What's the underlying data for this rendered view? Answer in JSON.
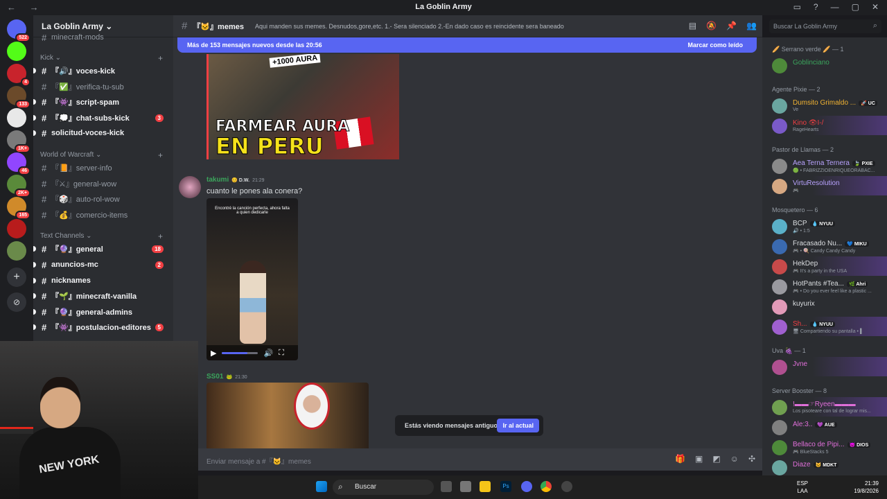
{
  "window": {
    "title": "La Goblin Army",
    "nav": "← →",
    "controls": [
      "▭",
      "?",
      "—",
      "▢",
      "✕"
    ]
  },
  "servers": [
    {
      "color": "#5865f2",
      "badge": "522",
      "icon": "discord-home-icon"
    },
    {
      "color": "#53fc18",
      "badge": "",
      "icon": "kick-icon"
    },
    {
      "color": "#c8232c",
      "badge": "4",
      "icon": "server-icon"
    },
    {
      "color": "#6b4a2a",
      "badge": "133",
      "icon": "server-icon"
    },
    {
      "color": "#e8e8e8",
      "badge": "",
      "icon": "server-icon"
    },
    {
      "color": "#7a7a7a",
      "badge": "1K+",
      "icon": "server-icon"
    },
    {
      "color": "#9146ff",
      "badge": "46",
      "icon": "twitch-icon"
    },
    {
      "color": "#5a8a3a",
      "badge": "2K+",
      "icon": "server-icon"
    },
    {
      "color": "#d08a2a",
      "badge": "165",
      "icon": "server-icon"
    },
    {
      "color": "#b81c1c",
      "badge": "",
      "icon": "server-icon"
    },
    {
      "color": "#6a8a4a",
      "badge": "",
      "icon": "server-icon"
    }
  ],
  "guild": {
    "name": "La Goblin Army ⌄",
    "top_channel": "minecraft-mods"
  },
  "categories": {
    "kick": "Kick ⌄",
    "wow": "World of Warcraft ⌄",
    "text": "Text Channels ⌄"
  },
  "channels": [
    {
      "name": "『🔊』voces-kick",
      "unread": true
    },
    {
      "name": "『✅』verifica-tu-sub",
      "unread": false
    },
    {
      "name": "『👾』script-spam",
      "unread": true
    },
    {
      "name": "『💭』chat-subs-kick",
      "unread": true,
      "count": "3"
    },
    {
      "name": "solicitud-voces-kick",
      "unread": true
    },
    {
      "name": "『📙』server-info",
      "unread": false
    },
    {
      "name": "『⚔』general-wow",
      "unread": false
    },
    {
      "name": "『🎲』auto-rol-wow",
      "unread": false
    },
    {
      "name": "『💰』comercio-items",
      "unread": false
    },
    {
      "name": "『🔮』general",
      "unread": true,
      "count": "18"
    },
    {
      "name": "anuncios-mc",
      "unread": true,
      "count": "2"
    },
    {
      "name": "nicknames",
      "unread": true
    },
    {
      "name": "『🌱』minecraft-vanilla",
      "unread": true
    },
    {
      "name": "『🔮』general-admins",
      "unread": true
    },
    {
      "name": "『👾』postulacion-editores",
      "unread": true,
      "count": "5"
    }
  ],
  "chat": {
    "channel": "『🐱』memes",
    "topic": "Aqui manden sus memes. Desnudos,gore,etc. 1.- Sera silenciado 2.-En dado caso es reincidente sera baneado",
    "new_messages": "Más de 153 mensajes nuevos desde las 20:56",
    "mark_read": "Marcar como leído",
    "thumb": {
      "aura": "+1000 AURA",
      "line1": "FARMEAR AURA",
      "line2": "EN PERU"
    },
    "messages": [
      {
        "user": "takumi",
        "tag": "😊 D.W.",
        "time": "21:29",
        "text": "cuanto le pones ala conera?",
        "color": "#3ba55c",
        "video_caption": "Encontré la canción perfecta, ahora falta a quien dedicarle",
        "progress": 0.7
      },
      {
        "user": "SS01",
        "tag": "🐸",
        "time": "21:30",
        "text": "",
        "color": "#3ba55c"
      }
    ],
    "old_notice": "Estás viendo mensajes antiguos",
    "jump": "Ir al actual",
    "composer_placeholder": "Enviar mensaje a #『🐱』memes"
  },
  "search": {
    "placeholder": "Buscar La Goblin Army"
  },
  "members": {
    "groups": [
      {
        "title": "🥖 Serrano verde 🥖 — 1",
        "items": [
          {
            "name": "Goblinciano",
            "color": "#3ba55c",
            "status": "",
            "tag": "",
            "boost": false
          }
        ]
      },
      {
        "title": "Agente Pixie — 2",
        "items": [
          {
            "name": "Dumsito Grimaldo ...",
            "color": "#f0b232",
            "status": "Ve",
            "tag": "🚀 UC",
            "boost": false
          },
          {
            "name": "Kino 👁I-/",
            "color": "#f23f43",
            "status": "RageHearts",
            "tag": "",
            "boost": true
          }
        ]
      },
      {
        "title": "Pastor de Llamas — 2",
        "items": [
          {
            "name": "Aea Terna Ternera",
            "color": "#b9a3ff",
            "status": "🟢 • FABRIZZIOENRIQUEORABAC...",
            "tag": "🍃 PXIE",
            "boost": false
          },
          {
            "name": "VirtuResolution",
            "color": "#b9a3ff",
            "status": "🎮",
            "tag": "",
            "boost": true
          }
        ]
      },
      {
        "title": "Mosquetero — 6",
        "items": [
          {
            "name": "BCP",
            "color": "#dbdee1",
            "status": "🔊 • 1:5",
            "tag": "💧 NYUU",
            "boost": false
          },
          {
            "name": "Fracasado Nu...",
            "color": "#dbdee1",
            "status": "🎮 • 🍭 Candy Candy Candy",
            "tag": "💙 MIKU",
            "boost": false
          },
          {
            "name": "HekDep",
            "color": "#dbdee1",
            "status": "🎮 It's a party in the USA",
            "tag": "",
            "boost": true
          },
          {
            "name": "HotPants #Tea...",
            "color": "#dbdee1",
            "status": "🎮 • Do you ever feel like a plastic ...",
            "tag": "🌿 Ahri",
            "boost": false
          },
          {
            "name": "kuyurix",
            "color": "#dbdee1",
            "status": "",
            "tag": "",
            "boost": false
          },
          {
            "name": "Sh...",
            "color": "#f23f43",
            "status": "🖥 Compartiendo su pantalla • ▌",
            "tag": "💧 NYUU",
            "boost": true
          }
        ]
      },
      {
        "title": "Uva 🍇 — 1",
        "items": [
          {
            "name": "Jvne",
            "color": "#e06fd9",
            "status": "",
            "tag": "",
            "boost": true
          }
        ]
      },
      {
        "title": "Server Booster — 8",
        "items": [
          {
            "name": "!▬▬☞Ryeen▬▬▬",
            "color": "#e06fd9",
            "status": "Los pisoteare con tal de lograr mis...",
            "tag": "",
            "boost": true
          },
          {
            "name": "Ale:3..",
            "color": "#e06fd9",
            "status": "",
            "tag": "💜 AUE",
            "boost": false
          },
          {
            "name": "Bellaco de Pipi...",
            "color": "#e06fd9",
            "status": "🎮 BlueStacks 5",
            "tag": "😈 DIOS",
            "boost": false
          },
          {
            "name": "Diaze",
            "color": "#e06fd9",
            "status": "",
            "tag": "😺 MDKT",
            "boost": false
          }
        ]
      }
    ]
  },
  "taskbar": {
    "search": "Buscar",
    "lang1": "ESP",
    "lang2": "LAA",
    "time": "21:39",
    "date": "19/8/2026"
  }
}
